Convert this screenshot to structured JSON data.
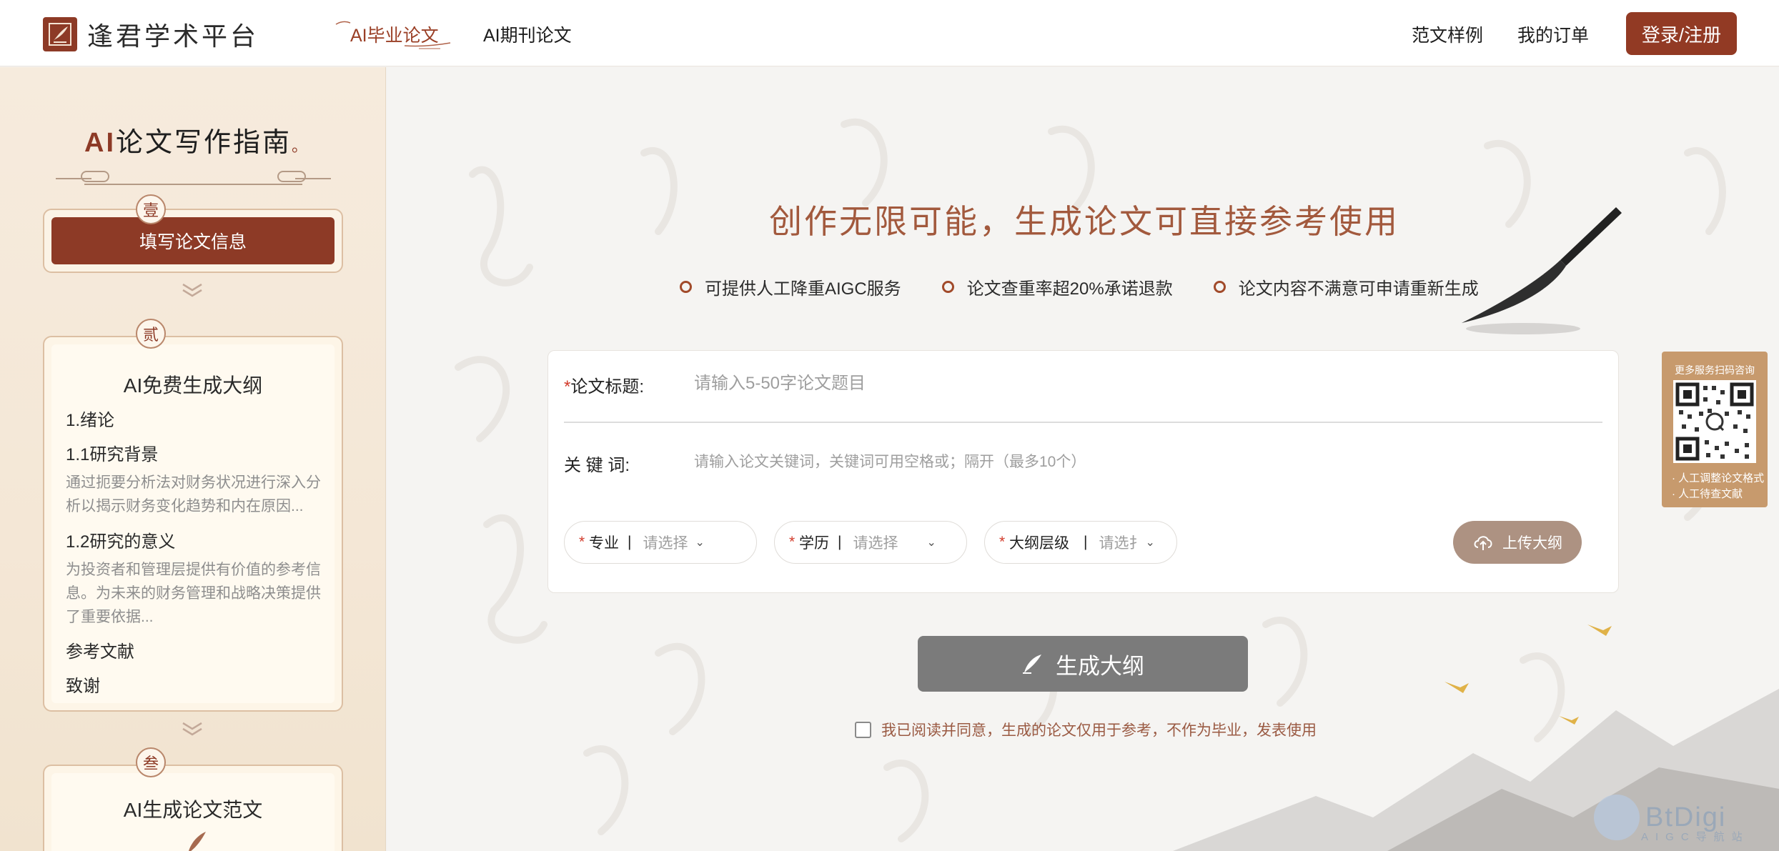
{
  "header": {
    "brand_name": "逢君学术平台",
    "nav": [
      {
        "label": "AI毕业论文",
        "active": true
      },
      {
        "label": "AI期刊论文",
        "active": false
      }
    ],
    "links": [
      {
        "label": "范文样例"
      },
      {
        "label": "我的订单"
      }
    ],
    "login_label": "登录/注册"
  },
  "sidebar": {
    "title_ai": "AI",
    "title_rest": "论文写作指南",
    "title_dot": "。",
    "steps": [
      {
        "badge": "壹",
        "label": "填写论文信息"
      },
      {
        "badge": "贰",
        "heading": "AI免费生成大纲",
        "items": {
          "ch1": "1.绪论",
          "ch1_1": "1.1研究背景",
          "ch1_1_desc": "通过扼要分析法对财务状况进行深入分析以揭示财务变化趋势和内在原因...",
          "ch1_2": "1.2研究的意义",
          "ch1_2_desc": "为投资者和管理层提供有价值的参考信息。为未来的财务管理和战略决策提供了重要依据...",
          "refs": "参考文献",
          "thanks": "致谢"
        }
      },
      {
        "badge": "叁",
        "heading": "AI生成论文范文"
      }
    ]
  },
  "main": {
    "hero_title": "创作无限可能，生成论文可直接参考使用",
    "features": [
      "可提供人工降重AIGC服务",
      "论文查重率超20%承诺退款",
      "论文内容不满意可申请重新生成"
    ],
    "form": {
      "title_label": "论文标题:",
      "title_placeholder": "请输入5-50字论文题目",
      "keywords_label": "关 键 词:",
      "keywords_placeholder": "请输入论文关键词，关键词可用空格或；隔开（最多10个）",
      "major_label": "专业",
      "major_placeholder": "请选择",
      "degree_label": "学历",
      "degree_placeholder": "请选择",
      "outline_label": "大纲层级",
      "outline_placeholder": "请选扌",
      "upload_label": "上传大纲"
    },
    "generate_label": "生成大纲",
    "agree_text": "我已阅读并同意，生成的论文仅用于参考，不作为毕业，发表使用"
  },
  "qr_panel": {
    "top_text": "更多服务扫码咨询",
    "lines": [
      "· 人工调整论文格式",
      "· 人工待查文献"
    ]
  },
  "watermark": {
    "text": "BtDigi",
    "sub": "AIGC导航站"
  },
  "colors": {
    "accent": "#8d3a26",
    "hero": "#a2593d",
    "button_disabled": "#7b7b7b",
    "upload": "#ad9282",
    "qr_panel": "#c79a6d"
  }
}
